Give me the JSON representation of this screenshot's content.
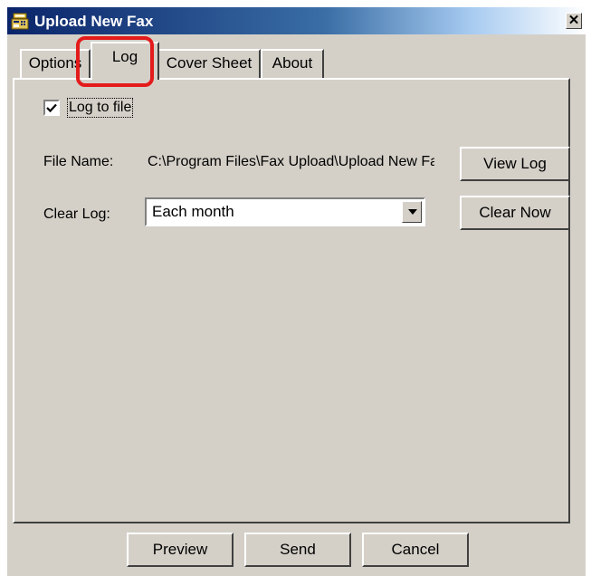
{
  "window": {
    "title": "Upload New Fax",
    "close_glyph": "✕",
    "icon": "fax-app-icon"
  },
  "tabs": [
    {
      "label": "Options",
      "selected": false
    },
    {
      "label": "Log",
      "selected": true
    },
    {
      "label": "Cover Sheet",
      "selected": false
    },
    {
      "label": "About",
      "selected": false
    }
  ],
  "log": {
    "log_to_file_label": "Log to file",
    "log_to_file_checked": true,
    "file_name_label": "File Name:",
    "file_name_value": "C:\\Program Files\\Fax Upload\\Upload New Fax.log",
    "view_log_label": "View Log",
    "clear_log_label": "Clear Log:",
    "clear_log_selected": "Each month",
    "clear_now_label": "Clear Now"
  },
  "footer": {
    "preview_label": "Preview",
    "send_label": "Send",
    "cancel_label": "Cancel"
  },
  "colors": {
    "dialog_face": "#d4d0c8",
    "title_gradient_start": "#0a246a",
    "highlight": "#e41b1b"
  }
}
